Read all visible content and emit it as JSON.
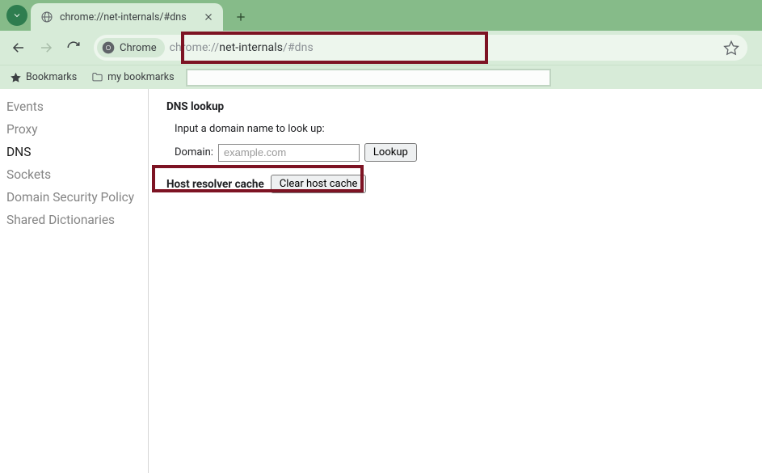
{
  "tab": {
    "title": "chrome://net-internals/#dns"
  },
  "address_chip": "Chrome",
  "url_gray_prefix": "chrome://",
  "url_bold": "net-internals",
  "url_gray_suffix": "/#dns",
  "bookmarks": {
    "button": "Bookmarks",
    "folder": "my bookmarks"
  },
  "sidebar": {
    "items": [
      {
        "label": "Events"
      },
      {
        "label": "Proxy"
      },
      {
        "label": "DNS"
      },
      {
        "label": "Sockets"
      },
      {
        "label": "Domain Security Policy"
      },
      {
        "label": "Shared Dictionaries"
      }
    ],
    "active_index": 2
  },
  "dns": {
    "title": "DNS lookup",
    "prompt": "Input a domain name to look up:",
    "domain_label": "Domain:",
    "domain_placeholder": "example.com",
    "domain_value": "",
    "lookup_button": "Lookup",
    "host_cache_label": "Host resolver cache",
    "clear_button": "Clear host cache"
  }
}
